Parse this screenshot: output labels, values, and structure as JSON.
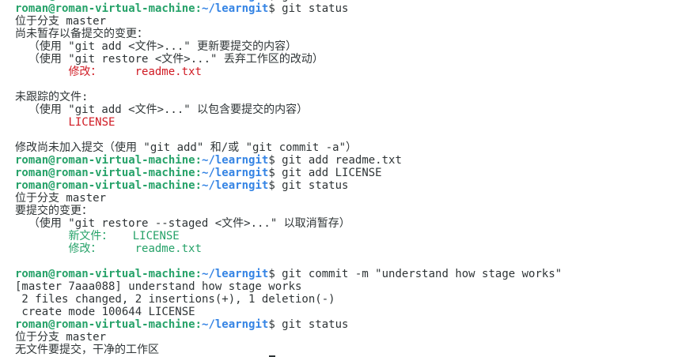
{
  "prompt": {
    "user_host": "roman@roman-virtual-machine",
    "sep": ":",
    "path": "~/learngit",
    "sigil": "$ "
  },
  "lines": [
    {
      "type": "prompt",
      "cmd": "git status"
    },
    {
      "type": "prompt",
      "cmd": "git status"
    },
    {
      "type": "text",
      "text": "位于分支 master"
    },
    {
      "type": "text",
      "text": "尚未暂存以备提交的变更："
    },
    {
      "type": "text",
      "text": "  （使用 \"git add <文件>...\" 更新要提交的内容）"
    },
    {
      "type": "text",
      "text": "  （使用 \"git restore <文件>...\" 丢弃工作区的改动）"
    },
    {
      "type": "red",
      "text": "\t修改：     readme.txt"
    },
    {
      "type": "blank"
    },
    {
      "type": "text",
      "text": "未跟踪的文件:"
    },
    {
      "type": "text",
      "text": "  （使用 \"git add <文件>...\" 以包含要提交的内容）"
    },
    {
      "type": "red",
      "text": "\tLICENSE"
    },
    {
      "type": "blank"
    },
    {
      "type": "text",
      "text": "修改尚未加入提交（使用 \"git add\" 和/或 \"git commit -a\"）"
    },
    {
      "type": "prompt",
      "cmd": "git add readme.txt"
    },
    {
      "type": "prompt",
      "cmd": "git add LICENSE"
    },
    {
      "type": "prompt",
      "cmd": "git status"
    },
    {
      "type": "text",
      "text": "位于分支 master"
    },
    {
      "type": "text",
      "text": "要提交的变更："
    },
    {
      "type": "text",
      "text": "  （使用 \"git restore --staged <文件>...\" 以取消暂存）"
    },
    {
      "type": "green",
      "text": "\t新文件：   LICENSE"
    },
    {
      "type": "green",
      "text": "\t修改：     readme.txt"
    },
    {
      "type": "blank"
    },
    {
      "type": "prompt",
      "cmd": "git commit -m \"understand how stage works\""
    },
    {
      "type": "text",
      "text": "[master 7aaa088] understand how stage works"
    },
    {
      "type": "text",
      "text": " 2 files changed, 2 insertions(+), 1 deletion(-)"
    },
    {
      "type": "text",
      "text": " create mode 100644 LICENSE"
    },
    {
      "type": "prompt",
      "cmd": "git status"
    },
    {
      "type": "text",
      "text": "位于分支 master"
    },
    {
      "type": "text",
      "text": "无文件要提交，干净的工作区"
    }
  ],
  "colors": {
    "user": "#26a269",
    "path": "#3584e4",
    "red": "#d01b24",
    "green": "#26a269",
    "text": "#2e3436",
    "background": "#ffffff"
  }
}
